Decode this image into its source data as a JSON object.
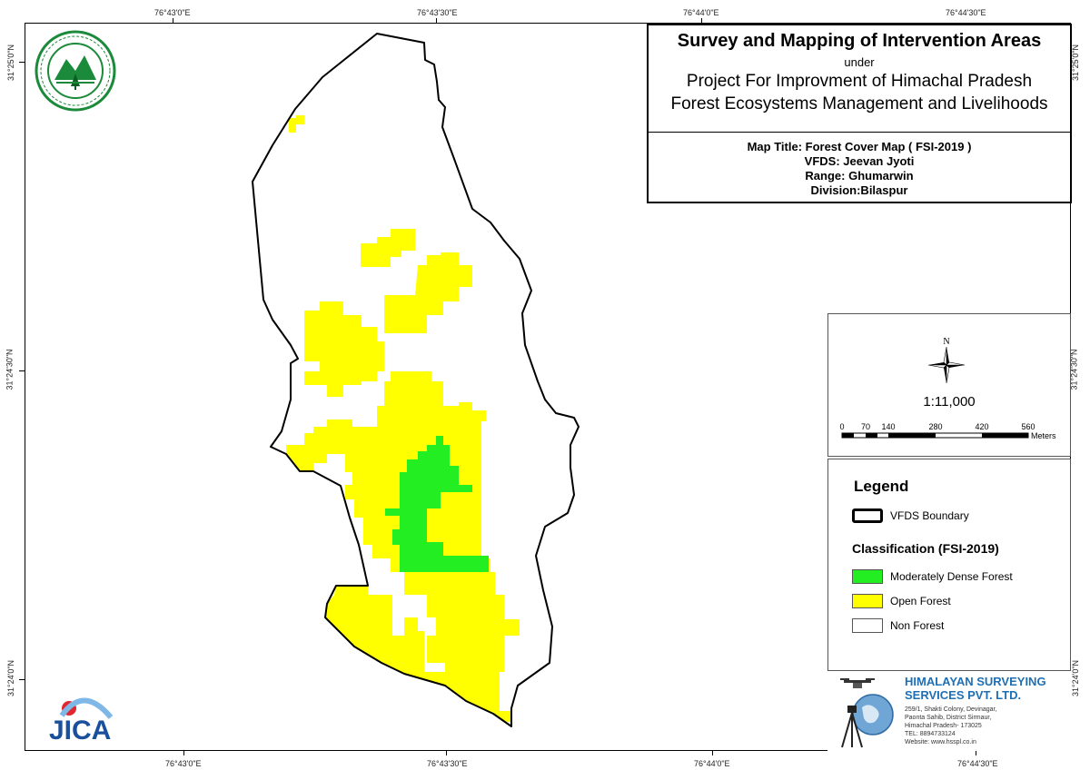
{
  "title_block": {
    "main_title": "Survey and Mapping of Intervention Areas",
    "under": "under",
    "project_line1": "Project For Improvment of Himachal Pradesh",
    "project_line2": "Forest Ecosystems Management and Livelihoods",
    "map_title": "Map Title: Forest Cover Map ( FSI-2019 )",
    "vfds": "VFDS: Jeevan Jyoti",
    "range": "Range: Ghumarwin",
    "division": "Division:Bilaspur"
  },
  "graticule": {
    "top_labels": [
      "76°43'0\"E",
      "76°43'30\"E",
      "76°44'0\"E",
      "76°44'30\"E"
    ],
    "bottom_labels": [
      "76°43'0\"E",
      "76°43'30\"E",
      "76°44'0\"E",
      "76°44'30\"E"
    ],
    "left_labels": [
      "31°25'0\"N",
      "31°24'30\"N",
      "31°24'0\"N"
    ],
    "right_labels": [
      "31°25'0\"N",
      "31°24'30\"N",
      "31°24'0\"N"
    ]
  },
  "north_arrow": {
    "letter": "N"
  },
  "scale": {
    "ratio": "1:11,000",
    "ticks": [
      "0",
      "70",
      "140",
      "280",
      "420",
      "560"
    ],
    "unit": "Meters"
  },
  "legend": {
    "title": "Legend",
    "boundary_label": "VFDS Boundary",
    "classification_title": "Classification (FSI-2019)",
    "classes": [
      {
        "label": "Moderately Dense Forest",
        "color": "#22ee22"
      },
      {
        "label": "Open Forest",
        "color": "#ffff00"
      },
      {
        "label": "Non Forest",
        "color": "#ffffff"
      }
    ]
  },
  "company": {
    "name_line1": "HIMALAYAN SURVEYING",
    "name_line2": "SERVICES PVT. LTD.",
    "address_lines": [
      "259/1, Shakti Colony, Devinagar,",
      "Paonta Sahib, District Sirmaur,",
      "Himachal Pradesh- 173025",
      "TEL: 8894733124",
      "Website: www.hsspl.co.in"
    ]
  },
  "logos": {
    "top_left": "forest-department-seal",
    "bottom_left": "JICA",
    "company_icon": "drone-globe-tripod-icon"
  },
  "colors": {
    "moderately_dense": "#22ee22",
    "open_forest": "#ffff00",
    "boundary": "#000000",
    "company_blue": "#1f6fb5",
    "jica_blue": "#1a4f9c",
    "jica_red": "#e0262e"
  }
}
